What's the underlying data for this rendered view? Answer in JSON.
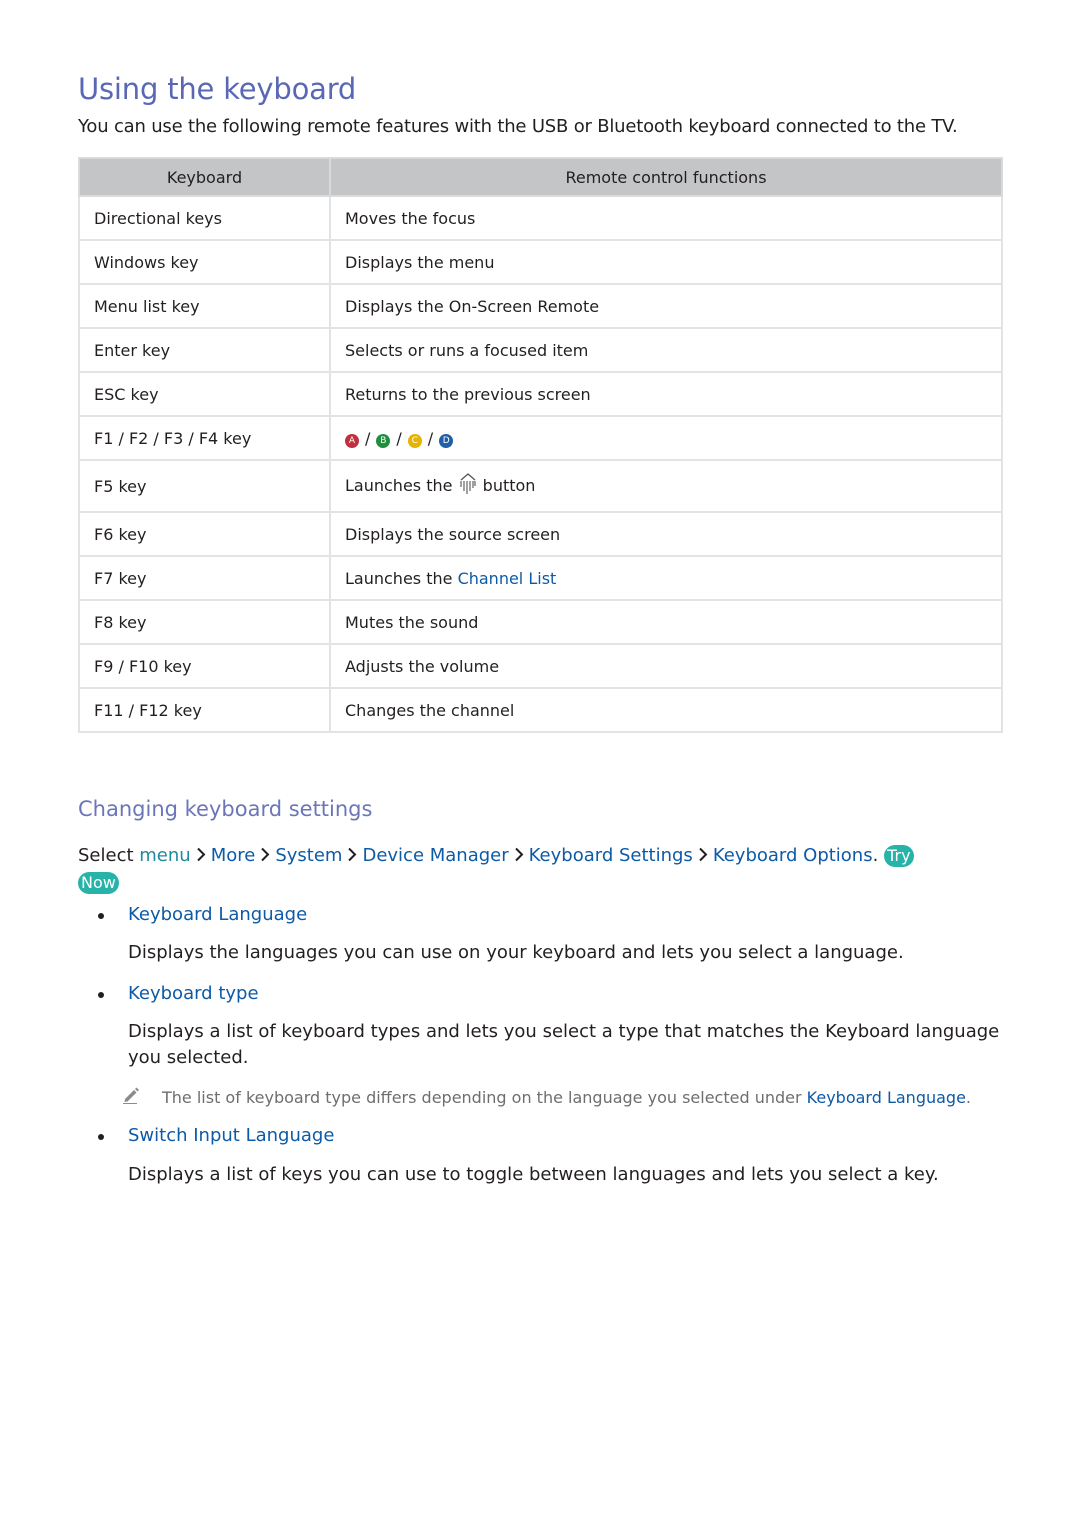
{
  "title": "Using the keyboard",
  "intro": "You can use the following remote features with the USB or Bluetooth keyboard connected to the TV.",
  "table": {
    "headers": [
      "Keyboard",
      "Remote control functions"
    ],
    "rows": [
      {
        "key": "Directional keys",
        "function": "Moves the focus"
      },
      {
        "key": "Windows key",
        "function": "Displays the menu"
      },
      {
        "key": "Menu list key",
        "function": "Displays the On-Screen Remote"
      },
      {
        "key": "Enter key",
        "function": "Selects or runs a focused item"
      },
      {
        "key": "ESC key",
        "function": "Returns to the previous screen"
      },
      {
        "key": "F1 / F2 / F3 / F4 key",
        "color_buttons": [
          {
            "label": "A",
            "color": "#c0303f"
          },
          {
            "label": "B",
            "color": "#1f8f3f"
          },
          {
            "label": "C",
            "color": "#e6b400"
          },
          {
            "label": "D",
            "color": "#1f5fa8"
          }
        ],
        "separator": "/"
      },
      {
        "key": "F5 key",
        "function_pre": "Launches the",
        "function_icon": "smart-hub-icon",
        "function_post": "button"
      },
      {
        "key": "F6 key",
        "function": "Displays the source screen"
      },
      {
        "key": "F7 key",
        "function_pre": "Launches the",
        "function_link": "Channel List"
      },
      {
        "key": "F8 key",
        "function": "Mutes the sound"
      },
      {
        "key": "F9 / F10 key",
        "function": "Adjusts the volume"
      },
      {
        "key": "F11 / F12 key",
        "function": "Changes the channel"
      }
    ]
  },
  "section": {
    "title": "Changing keyboard settings",
    "path_prefix": "Select",
    "path": [
      "menu",
      "More",
      "System",
      "Device Manager",
      "Keyboard Settings",
      "Keyboard Options"
    ],
    "path_suffix": ".",
    "try_now": [
      "Try",
      "Now"
    ],
    "items": [
      {
        "title": "Keyboard Language",
        "desc": "Displays the languages you can use on your keyboard and lets you select a language."
      },
      {
        "title": "Keyboard type",
        "desc": "Displays a list of keyboard types and lets you select a type that matches the Keyboard language you selected."
      },
      {
        "title": "Switch Input Language",
        "desc": "Displays a list of keys you can use to toggle between languages and lets you select a key."
      }
    ],
    "note": {
      "text": "The list of keyboard type differs depending on the language you selected under",
      "link": "Keyboard Language",
      "end": "."
    }
  },
  "colors": {
    "title": "#5a67b5",
    "link": "#0d5aa7",
    "menu": "#1e8a9e",
    "try_now_badge": "#28b3a8",
    "table_header": "#c4c5c7"
  }
}
